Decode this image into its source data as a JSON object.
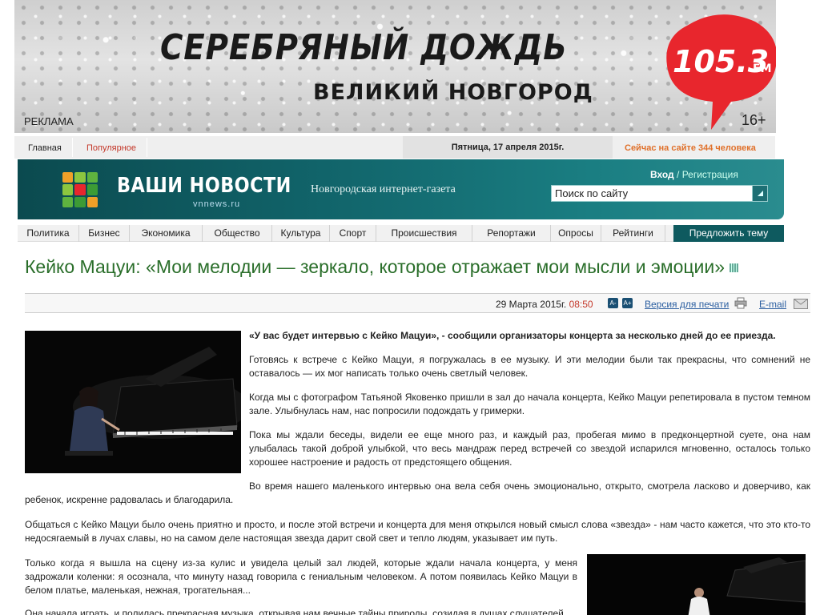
{
  "banner": {
    "title": "СЕРЕБРЯНЫЙ ДОЖДЬ",
    "subtitle": "ВЕЛИКИЙ НОВГОРОД",
    "frequency": "105.3",
    "frequency_unit": "FM",
    "ad_label": "РЕКЛАМА",
    "age_rating": "16+",
    "accent_color": "#e8262d"
  },
  "topbar": {
    "home": "Главная",
    "popular": "Популярное",
    "date": "Пятница, 17 апреля 2015г.",
    "online": "Сейчас на сайте 344 человека"
  },
  "header": {
    "site_name": "ВАШИ НОВОСТИ",
    "domain": "vnnews.ru",
    "tagline": "Новгородская интернет-газета",
    "login": "Вход",
    "separator": " / ",
    "register": "Регистрация",
    "search_placeholder": "Поиск по сайту",
    "color": "#11646a"
  },
  "nav": {
    "items": [
      "Политика",
      "Бизнес",
      "Экономика",
      "Общество",
      "Культура",
      "Спорт",
      "Происшествия",
      "Репортажи",
      "Опросы",
      "Рейтинги"
    ],
    "suggest": "Предложить тему"
  },
  "article": {
    "title": "Кейко Мацуи: «Мои мелодии — зеркало, которое отражает мои мысли и эмоции»",
    "date": "29 Марта 2015г.",
    "time": "08:50",
    "font_smaller": "A-",
    "font_larger": "A+",
    "print": "Версия для печати",
    "email": "E-mail",
    "lead": "«У вас будет интервью с Кейко Мацуи», - сообщили организаторы концерта за несколько дней до ее приезда.",
    "paragraphs": [
      "Готовясь к встрече с Кейко Мацуи, я погружалась в ее музыку. И эти мелодии были так прекрасны, что сомнений не оставалось — их мог написать только очень светлый человек.",
      "Когда мы с фотографом Татьяной Яковенко пришли в зал до начала концерта, Кейко Мацуи репетировала в пустом темном зале. Улыбнулась нам, нас попросили подождать у гримерки.",
      "Пока мы ждали беседы, видели ее еще много раз, и каждый раз, пробегая мимо в предконцертной суете, она нам улыбалась такой доброй улыбкой, что весь мандраж перед встречей со звездой испарился мгновенно, осталось только хорошее настроение и радость от предстоящего общения.",
      "Во время нашего маленького интервью она вела себя очень эмоционально, открыто, смотрела ласково и доверчиво, как ребенок, искренне радовалась и благодарила.",
      "Общаться с Кейко Мацуи было очень приятно и просто, и после этой встречи и концерта для меня открылся новый смысл слова «звезда» - нам часто кажется, что это кто-то недосягаемый в лучах славы, но на самом деле настоящая звезда дарит свой свет и тепло людям, указывает им путь.",
      "Только когда я вышла на сцену из-за кулис и увидела целый зал людей, которые ждали начала концерта, у меня задрожали коленки: я осознала, что минуту назад говорила с гениальным человеком. А потом появилась Кейко Мацуи в белом платье, маленькая, нежная, трогательная...",
      "Она начала играть, и полилась прекрасная музыка, открывая нам вечные тайны природы, созидая в душах слушателей"
    ]
  }
}
